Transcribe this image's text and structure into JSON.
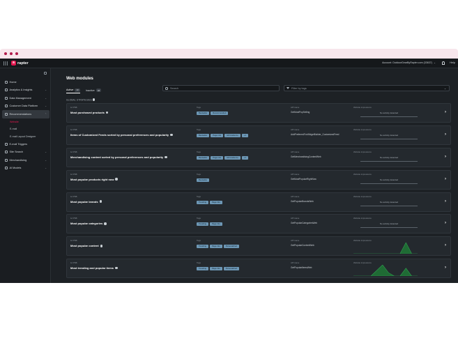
{
  "app": {
    "logo_text": "rapter",
    "logo_mark": "a",
    "account": "Account: OutdoorGearByRapter.com (33637)",
    "help": "Help"
  },
  "sidebar": {
    "items": [
      {
        "label": "Home",
        "icon": "home-icon"
      },
      {
        "label": "Analytics & Insights",
        "icon": "chart-icon"
      },
      {
        "label": "Data Management",
        "icon": "database-icon"
      },
      {
        "label": "Customer Data Platform",
        "icon": "cdp-icon"
      },
      {
        "label": "Recommendations",
        "icon": "star-icon"
      },
      {
        "label": "E-mail Triggers",
        "icon": "mail-icon"
      },
      {
        "label": "Site Search",
        "icon": "search-icon"
      },
      {
        "label": "Merchandising",
        "icon": "tag-icon"
      },
      {
        "label": "AI Models",
        "icon": "ai-icon"
      }
    ],
    "sub": [
      "Website",
      "E-mail",
      "E-mail Layout Designer"
    ]
  },
  "main": {
    "title": "Web modules",
    "tabs": [
      {
        "label": "Active",
        "count": "10"
      },
      {
        "label": "Inactive",
        "count": "38"
      }
    ],
    "search_placeholder": "Search",
    "filter_placeholder": "Filter by tags",
    "section_label": "GLOBAL STRATEGIES",
    "col_tags": "Tags",
    "col_api": "API name",
    "col_impr": "Website impressions",
    "no_activity": "No activity detected"
  },
  "cards": [
    {
      "meta": "1d PSB",
      "name": "Most purchased products",
      "tags": [
        "Bestseller",
        "Recommended"
      ],
      "api": "GetMostPopSelling",
      "spark": null
    },
    {
      "meta": "1d PSB",
      "name": "Items of Customized Feeds sorted by personal preferences and popularity",
      "tags": [
        "Bestseller",
        "Page info",
        "Gift Audience",
        "+1"
      ],
      "api": "AddPreferredForWidgetBuilder_CustomizedFeed",
      "spark": null
    },
    {
      "meta": "1d PSB",
      "name": "Merchandising content sorted by personal preferences and popularity",
      "tags": [
        "Bestseller",
        "Page info",
        "Gift Audience",
        "+1"
      ],
      "api": "GetMerchandisingContentWeb",
      "spark": null
    },
    {
      "meta": "1d PSB",
      "name": "Most popular products right now",
      "tags": [
        "Bestseller"
      ],
      "api": "GetMostPopularRightNow",
      "spark": null
    },
    {
      "meta": "1d PSB",
      "name": "Most popular brands",
      "tags": [
        "Trending",
        "Page info"
      ],
      "api": "GetPopularBrandsWeb",
      "spark": null
    },
    {
      "meta": "1d PSB",
      "name": "Most popular categories",
      "tags": [
        "Trending",
        "Page info"
      ],
      "api": "GetPopularCategoriesWeb",
      "spark": null
    },
    {
      "meta": "1d PSB",
      "name": "Most popular content",
      "tags": [
        "Trending",
        "Page info",
        "Personalized"
      ],
      "api": "GetPopularContentWeb",
      "spark": [
        0,
        0,
        0,
        0,
        0,
        0,
        0,
        0,
        0,
        1,
        0,
        0
      ]
    },
    {
      "meta": "1d PSB",
      "name": "Most trending and popular items",
      "tags": [
        "Trending",
        "Page info",
        "Personalized"
      ],
      "api": "GetPopularItemsWeb",
      "spark": [
        0,
        0,
        0,
        0,
        0.5,
        1,
        0.3,
        0,
        0,
        0.7,
        0,
        0
      ]
    }
  ]
}
